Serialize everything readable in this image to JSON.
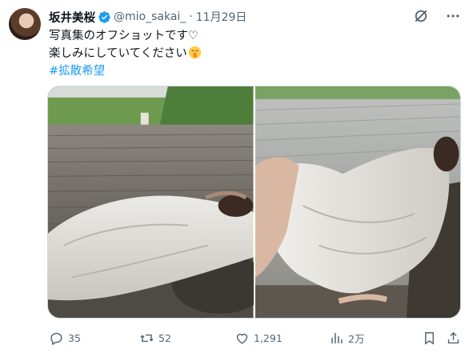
{
  "author": {
    "display_name": "坂井美桜",
    "handle": "@mio_sakai_",
    "separator": "·",
    "date": "11月29日"
  },
  "tweet": {
    "line1": "写真集のオフショットです♡",
    "line2": "楽しみにしていてください",
    "hashtag": "#拡散希望"
  },
  "actions": {
    "replies": "35",
    "retweets": "52",
    "likes": "1,291",
    "views": "2万"
  },
  "colors": {
    "accent": "#1d9bf0",
    "text": "#0f1419",
    "secondary": "#536471",
    "border": "#cfd9de"
  },
  "icons": {
    "verified": "verified-badge-icon",
    "grok": "grok-icon",
    "more": "more-icon",
    "reply": "reply-icon",
    "retweet": "retweet-icon",
    "like": "like-icon",
    "views": "views-icon",
    "bookmark": "bookmark-icon",
    "share": "share-icon"
  }
}
